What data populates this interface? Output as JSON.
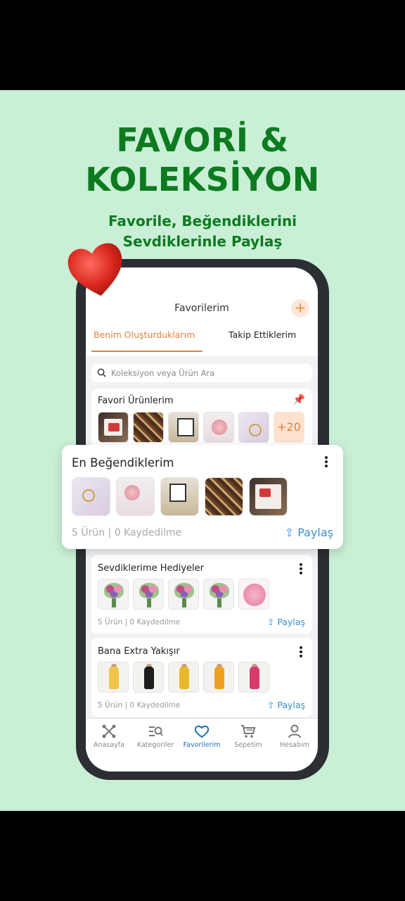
{
  "promo": {
    "headline_line1": "FAVORİ &",
    "headline_line2": "KOLEKSİYON",
    "subtitle_line1": "Favorile, Beğendiklerini",
    "subtitle_line2": "Sevdiklerinle Paylaş"
  },
  "header": {
    "title": "Favorilerim",
    "add_label": "+"
  },
  "tabs": [
    {
      "label": "Benim Oluşturduklarım",
      "active": true
    },
    {
      "label": "Takip Ettiklerim",
      "active": false
    }
  ],
  "search": {
    "placeholder": "Koleksiyon veya Ürün Ara"
  },
  "collections": [
    {
      "title": "Favori Ürünlerim",
      "pinned": true,
      "more_count": "+20"
    },
    {
      "title": "En Beğendiklerim",
      "meta": "5 Ürün | 0 Kaydedilme",
      "share": "Paylaş"
    },
    {
      "title": "Sevdiklerime Hediyeler",
      "meta": "5 Ürün | 0 Kaydedilme",
      "share": "Paylaş"
    },
    {
      "title": "Bana Extra Yakışır",
      "meta": "5 Ürün | 0 Kaydedilme",
      "share": "Paylaş"
    }
  ],
  "bottom_nav": [
    {
      "label": "Anasayfa",
      "icon": "home-icon"
    },
    {
      "label": "Kategoriler",
      "icon": "categories-icon"
    },
    {
      "label": "Favorilerim",
      "icon": "heart-icon",
      "active": true
    },
    {
      "label": "Sepetim",
      "icon": "cart-icon"
    },
    {
      "label": "Hesabım",
      "icon": "user-icon"
    }
  ],
  "colors": {
    "background": "#c9efd6",
    "headline": "#0d7a1f",
    "accent": "#e0823c",
    "share": "#3a8fd6"
  }
}
